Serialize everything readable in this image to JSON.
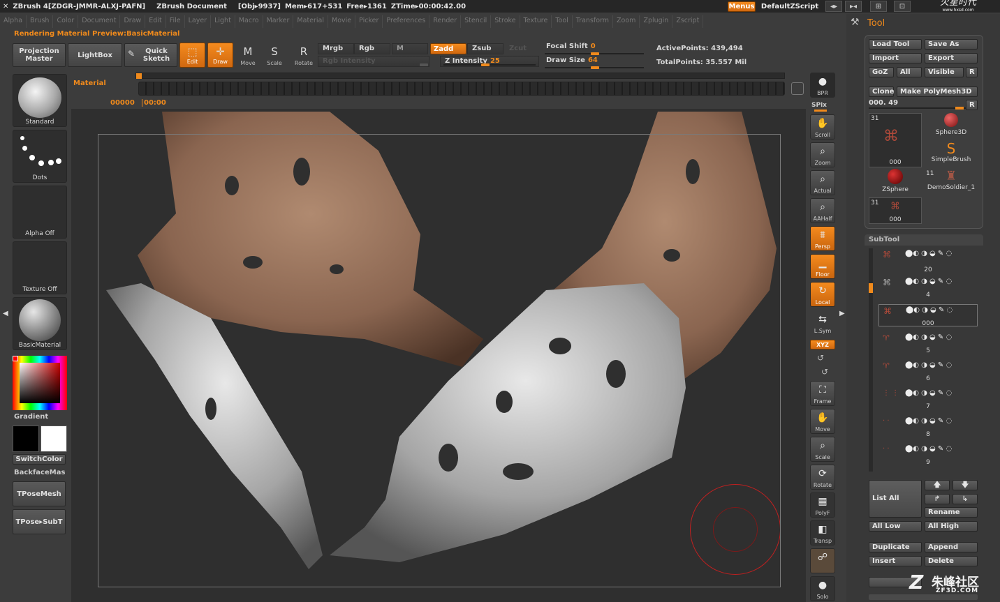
{
  "titlebar": {
    "app": "ZBrush 4[ZDGR-JMMR-ALXJ-PAFN]",
    "doc": "ZBrush Document",
    "obj": "[Obj▸9937]",
    "mem": "Mem▸617+531",
    "free": "Free▸1361",
    "ztime": "ZTime▸00:00:42.00",
    "menus": "Menus",
    "script": "DefaultZScript",
    "watermark": "火星时代",
    "watermark_url": "www.hxsd.com"
  },
  "menu": [
    "Alpha",
    "Brush",
    "Color",
    "Document",
    "Draw",
    "Edit",
    "File",
    "Layer",
    "Light",
    "Macro",
    "Marker",
    "Material",
    "Movie",
    "Picker",
    "Preferences",
    "Render",
    "Stencil",
    "Stroke",
    "Texture",
    "Tool",
    "Transform",
    "Zoom",
    "Zplugin",
    "Zscript"
  ],
  "preview_label": "Rendering Material Preview:BasicMaterial",
  "top": {
    "projection_master": "Projection Master",
    "lightbox": "LightBox",
    "quick_sketch": "Quick Sketch",
    "edit": "Edit",
    "draw": "Draw",
    "move": "Move",
    "scale": "Scale",
    "rotate": "Rotate",
    "mrgb": "Mrgb",
    "rgb": "Rgb",
    "m": "M",
    "zadd": "Zadd",
    "zsub": "Zsub",
    "zcut": "Zcut",
    "rgb_intensity": "Rgb Intensity",
    "z_intensity_label": "Z Intensity",
    "z_intensity": "25",
    "focal_shift_label": "Focal Shift",
    "focal_shift": "0",
    "draw_size_label": "Draw Size",
    "draw_size": "64",
    "active_points": "ActivePoints: 439,494",
    "total_points": "TotalPoints: 35.557 Mil",
    "timeline_label": "Material",
    "time_left": "00000",
    "time_right": "00:00"
  },
  "left": {
    "standard": "Standard",
    "dots": "Dots",
    "alpha_off": "Alpha Off",
    "texture_off": "Texture Off",
    "basic_material": "BasicMaterial",
    "gradient": "Gradient",
    "switch_color": "SwitchColor",
    "backface": "BackfaceMas",
    "tpose_mesh": "TPoseMesh",
    "tpose_subt": "TPose▸SubT"
  },
  "right_shelf": {
    "bpr": "BPR",
    "spix": "SPix",
    "scroll": "Scroll",
    "zoom": "Zoom",
    "actual": "Actual",
    "aahalf": "AAHalf",
    "persp": "Persp",
    "floor": "Floor",
    "local": "Local",
    "lsym": "L.Sym",
    "xyz": "XYZ",
    "frame": "Frame",
    "move": "Move",
    "scale": "Scale",
    "rotate": "Rotate",
    "polyf": "PolyF",
    "transp": "Transp",
    "solo": "Solo"
  },
  "tool": {
    "title": "Tool",
    "load_tool": "Load Tool",
    "save_as": "Save As",
    "import": "Import",
    "export": "Export",
    "goz": "GoZ",
    "all": "All",
    "visible": "Visible",
    "r": "R",
    "clone": "Clone",
    "make_polymesh": "Make PolyMesh3D",
    "slider_value": "000. 49",
    "thumbs": [
      {
        "count": "31",
        "label": "000"
      },
      {
        "count": "",
        "label": "Sphere3D"
      },
      {
        "count": "",
        "label": "SimpleBrush"
      },
      {
        "count": "",
        "label": "ZSphere"
      },
      {
        "count": "11",
        "label": "DemoSoldier_1"
      },
      {
        "count": "31",
        "label": "000"
      }
    ],
    "subtool_title": "SubTool",
    "subtools": [
      "20",
      "4",
      "000",
      "5",
      "6",
      "7",
      "8",
      "9"
    ],
    "list_all": "List All",
    "rename": "Rename",
    "all_low": "All Low",
    "all_high": "All High",
    "duplicate": "Duplicate",
    "append": "Append",
    "insert": "Insert",
    "delete": "Delete",
    "watermark": "朱峰社区",
    "watermark_url": "ZF3D.COM"
  },
  "colors": {
    "accent": "#f08a1c",
    "bg": "#3c3c3c",
    "canvas": "#2f2f2f"
  }
}
